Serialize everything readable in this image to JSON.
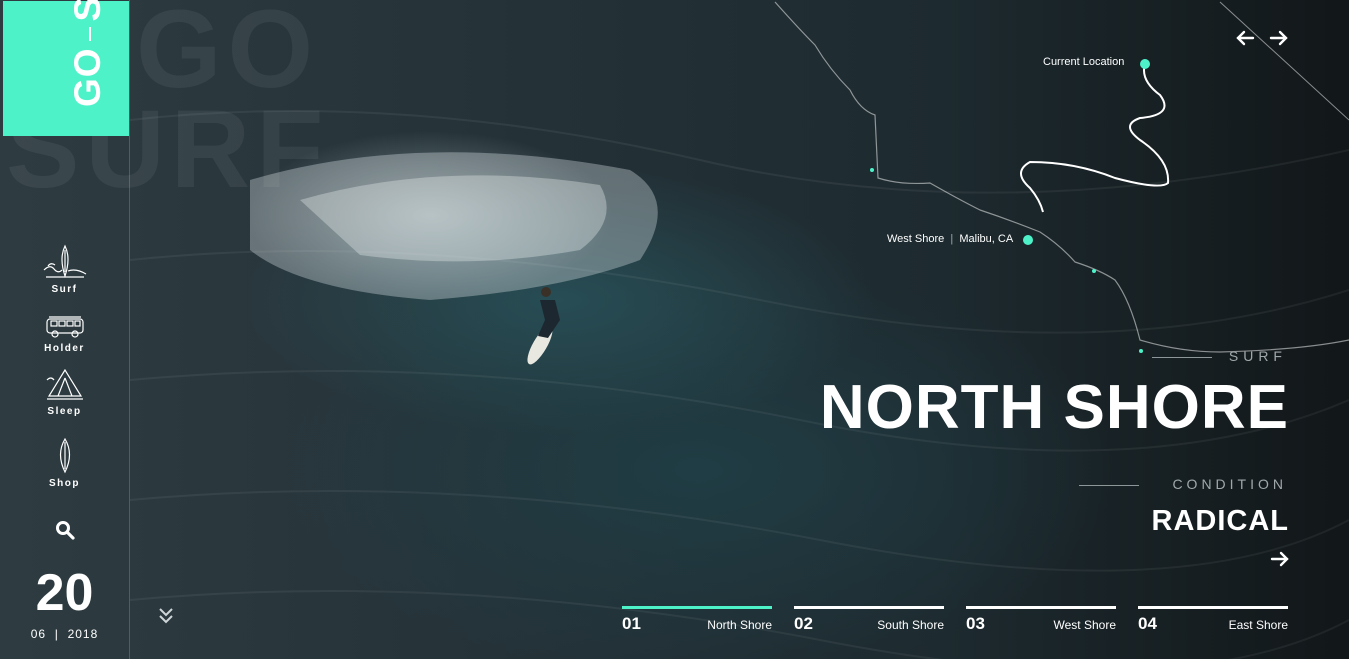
{
  "brand": {
    "go": "GO",
    "surf": "SURF",
    "ghost_line1": "GO",
    "ghost_line2": "SURF",
    "accent": "#4df2c9"
  },
  "nav": [
    {
      "label": "Surf",
      "icon": "surfboard-wave-icon"
    },
    {
      "label": "Holder",
      "icon": "van-icon"
    },
    {
      "label": "Sleep",
      "icon": "tent-icon"
    },
    {
      "label": "Shop",
      "icon": "surfboard-icon"
    }
  ],
  "search": {
    "icon": "search-icon"
  },
  "date": {
    "day": "20",
    "month": "06",
    "year": "2018"
  },
  "map": {
    "current_location": "Current Location",
    "west_shore": "West Shore",
    "west_shore_city": "Malibu, CA"
  },
  "hero": {
    "kicker": "SURF",
    "title": "NORTH SHORE",
    "condition_label": "CONDITION",
    "condition_value": "RADICAL"
  },
  "tabs": [
    {
      "num": "01",
      "name": "North Shore",
      "active": true
    },
    {
      "num": "02",
      "name": "South Shore",
      "active": false
    },
    {
      "num": "03",
      "name": "West Shore",
      "active": false
    },
    {
      "num": "04",
      "name": "East Shore",
      "active": false
    }
  ]
}
